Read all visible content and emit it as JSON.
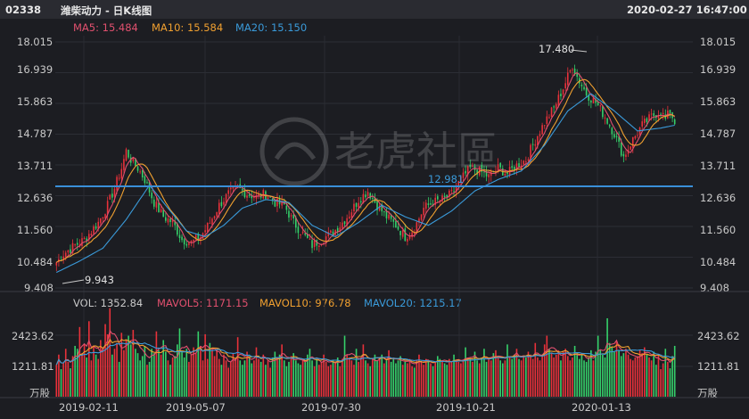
{
  "header": {
    "code": "02338",
    "title": "潍柴动力 - 日K线图",
    "datetime": "2020-02-27 16:47:00"
  },
  "ma_legend": [
    {
      "label": "MA5: 15.484",
      "color": "#e0506e"
    },
    {
      "label": "MA10: 15.584",
      "color": "#f0a030"
    },
    {
      "label": "MA20: 15.150",
      "color": "#3a9ad9"
    }
  ],
  "vol_legend": [
    {
      "label": "VOL: 1352.84",
      "color": "#c8c8c8"
    },
    {
      "label": "MAVOL5: 1171.15",
      "color": "#e0506e"
    },
    {
      "label": "MAVOL10: 976.78",
      "color": "#f0a030"
    },
    {
      "label": "MAVOL20: 1215.17",
      "color": "#3a9ad9"
    }
  ],
  "watermark": "老虎社區",
  "colors": {
    "up": "#e8313a",
    "down": "#35d06a",
    "ma5": "#e0506e",
    "ma10": "#f0a030",
    "ma20": "#3a9ad9",
    "hline": "#3a8fd8"
  },
  "chart_data": [
    {
      "type": "candlestick",
      "y_ticks": [
        "18.015",
        "16.939",
        "15.863",
        "14.787",
        "13.711",
        "12.636",
        "11.560",
        "10.484",
        "9.408"
      ],
      "ylim": [
        9.408,
        18.015
      ],
      "x_ticks": [
        "2019-02-11",
        "2019-05-07",
        "2019-07-30",
        "2019-10-21",
        "2020-01-13"
      ],
      "annotations": {
        "high": "17.480",
        "low": "9.943",
        "hline": "12.981"
      },
      "hline_value": 12.981,
      "close_path": [
        [
          0,
          10.3
        ],
        [
          3,
          10.6
        ],
        [
          8,
          10.9
        ],
        [
          12,
          11.1
        ],
        [
          18,
          11.7
        ],
        [
          22,
          12.3
        ],
        [
          25,
          12.9
        ],
        [
          28,
          13.6
        ],
        [
          30,
          14.2
        ],
        [
          32,
          13.9
        ],
        [
          35,
          13.6
        ],
        [
          38,
          13.2
        ],
        [
          42,
          12.4
        ],
        [
          46,
          11.9
        ],
        [
          50,
          11.7
        ],
        [
          54,
          11.1
        ],
        [
          58,
          11.0
        ],
        [
          62,
          11.2
        ],
        [
          66,
          11.7
        ],
        [
          70,
          12.3
        ],
        [
          74,
          12.7
        ],
        [
          78,
          12.9
        ],
        [
          82,
          12.7
        ],
        [
          86,
          12.6
        ],
        [
          90,
          12.7
        ],
        [
          94,
          12.4
        ],
        [
          98,
          12.3
        ],
        [
          102,
          11.7
        ],
        [
          106,
          11.3
        ],
        [
          110,
          10.9
        ],
        [
          114,
          11.1
        ],
        [
          118,
          11.3
        ],
        [
          122,
          11.6
        ],
        [
          126,
          12.0
        ],
        [
          130,
          12.5
        ],
        [
          134,
          12.8
        ],
        [
          138,
          12.3
        ],
        [
          142,
          11.9
        ],
        [
          146,
          11.6
        ],
        [
          150,
          11.2
        ],
        [
          154,
          11.5
        ],
        [
          158,
          12.2
        ],
        [
          162,
          12.4
        ],
        [
          166,
          12.5
        ],
        [
          170,
          12.7
        ],
        [
          174,
          13.2
        ],
        [
          178,
          13.6
        ],
        [
          182,
          13.5
        ],
        [
          186,
          13.3
        ],
        [
          190,
          13.6
        ],
        [
          194,
          13.4
        ],
        [
          198,
          13.7
        ],
        [
          202,
          13.9
        ],
        [
          206,
          14.6
        ],
        [
          210,
          15.2
        ],
        [
          214,
          15.7
        ],
        [
          218,
          16.4
        ],
        [
          222,
          17.2
        ],
        [
          224,
          16.8
        ],
        [
          228,
          16.2
        ],
        [
          232,
          15.9
        ],
        [
          236,
          15.4
        ],
        [
          240,
          14.8
        ],
        [
          244,
          14.0
        ],
        [
          248,
          14.6
        ],
        [
          252,
          15.1
        ],
        [
          256,
          15.4
        ],
        [
          260,
          15.6
        ],
        [
          262,
          15.3
        ],
        [
          264,
          15.6
        ],
        [
          266,
          15.2
        ]
      ],
      "ma20_path": [
        [
          0,
          9.95
        ],
        [
          10,
          10.35
        ],
        [
          20,
          10.8
        ],
        [
          30,
          11.8
        ],
        [
          40,
          13.0
        ],
        [
          48,
          12.2
        ],
        [
          56,
          11.4
        ],
        [
          64,
          11.2
        ],
        [
          72,
          11.6
        ],
        [
          80,
          12.2
        ],
        [
          90,
          12.5
        ],
        [
          100,
          12.4
        ],
        [
          110,
          11.6
        ],
        [
          120,
          11.2
        ],
        [
          130,
          11.7
        ],
        [
          140,
          12.3
        ],
        [
          150,
          11.9
        ],
        [
          160,
          11.6
        ],
        [
          170,
          12.1
        ],
        [
          180,
          12.8
        ],
        [
          190,
          13.2
        ],
        [
          200,
          13.5
        ],
        [
          210,
          14.4
        ],
        [
          220,
          15.6
        ],
        [
          230,
          16.2
        ],
        [
          240,
          15.6
        ],
        [
          250,
          14.9
        ],
        [
          260,
          15.0
        ],
        [
          266,
          15.1
        ]
      ],
      "volume": {
        "y_ticks": [
          "2423.62",
          "1211.81"
        ],
        "unit": "万股",
        "values": [
          1100,
          1450,
          950,
          1150,
          1650,
          1200,
          980,
          1400,
          1750,
          1650,
          2400,
          1500,
          1800,
          1350,
          2600,
          1250,
          1750,
          1450,
          1300,
          1950,
          1700,
          2500,
          2150,
          3050,
          1450,
          1650,
          1850,
          1200,
          2200,
          1600,
          1950,
          2100,
          1800,
          2300,
          1650,
          1500,
          1250,
          1400,
          1750,
          1100,
          1200,
          1650,
          1500,
          2250,
          1600,
          1450,
          1950,
          1550,
          1250,
          1100,
          1350,
          1400,
          1800,
          2350,
          1550,
          1350,
          1650,
          1200,
          1450,
          1700,
          1500,
          2250,
          1750,
          1250,
          2150,
          1300,
          1850,
          1600,
          1400,
          1650,
          1300,
          1100,
          1450,
          1250,
          1000,
          1200,
          1500,
          1300,
          2050,
          1250,
          1100,
          1250,
          1550,
          1400,
          1150,
          1250,
          1700,
          1300,
          1200,
          1450,
          1100,
          1250,
          1000,
          1350,
          1550,
          1300,
          1450,
          1800,
          1250,
          1050,
          1200,
          1400,
          1500,
          1250,
          1150,
          1100,
          1300,
          1200,
          1450,
          1650,
          1250,
          1050,
          1300,
          1100,
          1200,
          1450,
          1200,
          1050,
          1100,
          1250,
          1200,
          1350,
          1050,
          1300,
          2100,
          1450,
          1350,
          1250,
          1100,
          1650,
          1200,
          1350,
          1800,
          1250,
          1150,
          1050,
          1300,
          1450,
          1250,
          1350,
          1450,
          1150,
          1250,
          1600,
          1200,
          1300,
          1150,
          1250,
          1400,
          1100,
          1200,
          1150,
          1300,
          1050,
          1000,
          1250,
          1450,
          1200,
          1100,
          1300,
          1250,
          1150,
          1050,
          1200,
          1400,
          1300,
          1250,
          1150,
          1100,
          1300,
          1200,
          1450,
          1250,
          1200,
          1150,
          1250,
          1700,
          1350,
          1300,
          1200,
          1550,
          1250,
          1150,
          1350,
          1650,
          1200,
          1300,
          1250,
          1500,
          1600,
          1350,
          1250,
          1150,
          1250,
          1800,
          1350,
          1300,
          1450,
          1650,
          1300,
          1250,
          1400,
          1350,
          1550,
          1450,
          1300,
          1850,
          1350,
          1250,
          1400,
          1800,
          2100,
          1650,
          1500,
          1350,
          1450,
          1600,
          1250,
          1550,
          1650,
          1400,
          1250,
          1350,
          1750,
          1500,
          1300,
          1450,
          1250,
          1200,
          1350,
          1600,
          1250,
          1550,
          2100,
          1600,
          1450,
          1350,
          2700,
          1850,
          1700,
          1550,
          1900,
          1600,
          1400,
          1500,
          1650,
          1450,
          1300,
          1250,
          1350,
          1400,
          1600,
          1500,
          1700,
          1450,
          1350,
          1250,
          1550
        ]
      }
    }
  ]
}
